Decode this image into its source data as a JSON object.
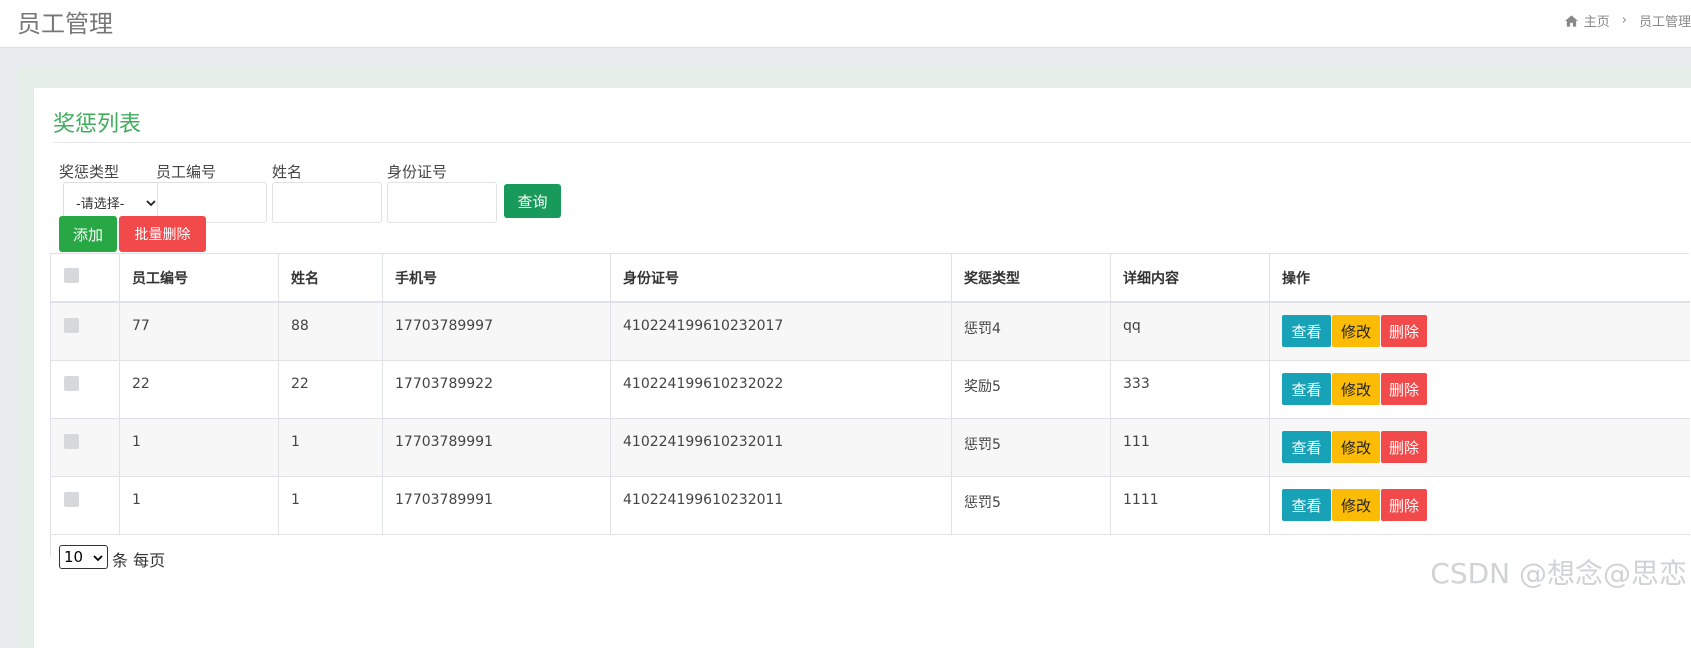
{
  "header": {
    "title": "员工管理",
    "breadcrumb": {
      "home": "主页",
      "separator": "›",
      "current": "员工管理"
    }
  },
  "panel": {
    "title": "奖惩列表"
  },
  "filters": {
    "type_label": "奖惩类型",
    "type_selected": "-请选择-",
    "emp_no_label": "员工编号",
    "name_label": "姓名",
    "id_card_label": "身份证号",
    "query_label": "查询"
  },
  "toolbar": {
    "add_label": "添加",
    "batch_delete_label": "批量删除"
  },
  "table": {
    "headers": [
      "员工编号",
      "姓名",
      "手机号",
      "身份证号",
      "奖惩类型",
      "详细内容",
      "操作"
    ],
    "rows": [
      {
        "emp_no": "77",
        "name": "88",
        "phone": "17703789997",
        "id_card": "410224199610232017",
        "type": "惩罚4",
        "detail": "qq"
      },
      {
        "emp_no": "22",
        "name": "22",
        "phone": "17703789922",
        "id_card": "410224199610232022",
        "type": "奖励5",
        "detail": "333"
      },
      {
        "emp_no": "1",
        "name": "1",
        "phone": "17703789991",
        "id_card": "410224199610232011",
        "type": "惩罚5",
        "detail": "111"
      },
      {
        "emp_no": "1",
        "name": "1",
        "phone": "17703789991",
        "id_card": "410224199610232011",
        "type": "惩罚5",
        "detail": "1111"
      }
    ],
    "actions": {
      "view": "查看",
      "edit": "修改",
      "delete": "删除"
    }
  },
  "pager": {
    "page_size": "10",
    "suffix": "条 每页"
  },
  "watermark": "CSDN @想念@思恋",
  "colors": {
    "accent_green": "#3fae5c",
    "view": "#17a2b8",
    "edit": "#fcbc05",
    "delete": "#f2494b"
  }
}
